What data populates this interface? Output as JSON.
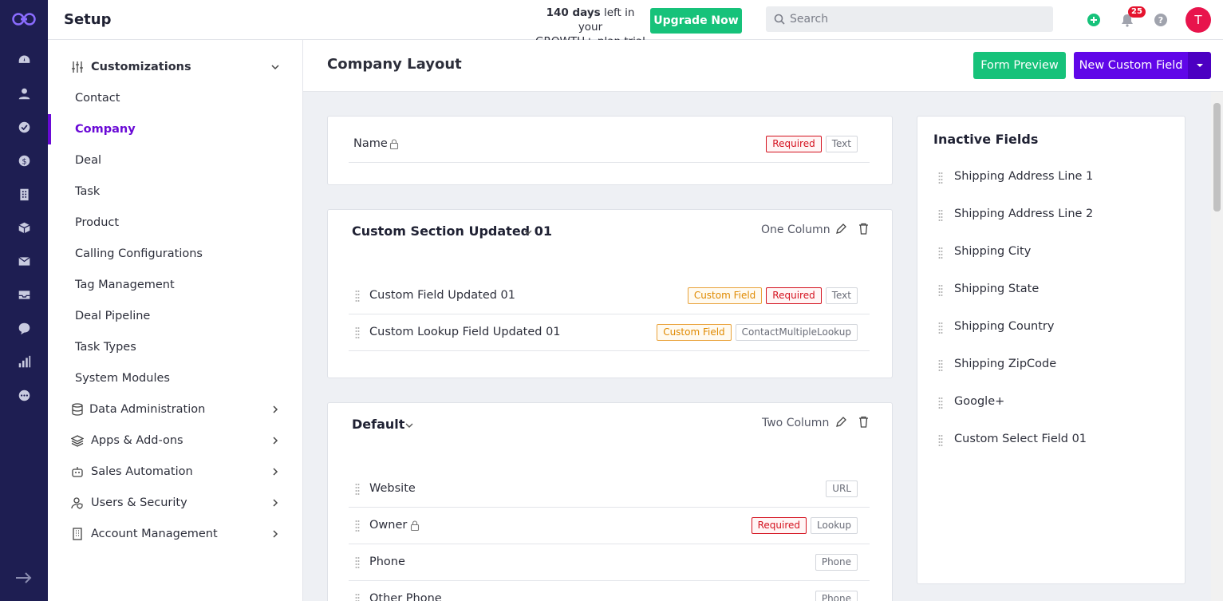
{
  "rail": {
    "icons": [
      "dashboard-icon",
      "contacts-icon",
      "tasks-icon",
      "deals-icon",
      "companies-icon",
      "products-icon",
      "email-icon",
      "inbox-icon",
      "chat-icon",
      "reports-icon",
      "more-icon"
    ],
    "accent": "#1e1e52"
  },
  "topbar": {
    "title": "Setup",
    "trial_days": "140 days",
    "trial_rest1": " left in your",
    "trial_line2": "GROWTH+ plan trial",
    "upgrade_label": "Upgrade Now",
    "search_placeholder": "Search",
    "notification_count": "25",
    "avatar_initial": "T"
  },
  "sidebar": {
    "customizations_label": "Customizations",
    "items": [
      "Contact",
      "Company",
      "Deal",
      "Task",
      "Product",
      "Calling Configurations",
      "Tag Management",
      "Deal Pipeline",
      "Task Types",
      "System Modules"
    ],
    "active_item": "Company",
    "groups": [
      "Data Administration",
      "Apps & Add-ons",
      "Sales Automation",
      "Users & Security",
      "Account Management"
    ]
  },
  "content": {
    "title": "Company Layout",
    "form_preview_label": "Form Preview",
    "new_field_label": "New Custom Field",
    "name_field": {
      "name": "Name",
      "tags": [
        "Required",
        "Text"
      ]
    },
    "sections": [
      {
        "title": "Custom Section Updated 01",
        "columns": "One Column",
        "fields": [
          {
            "name": "Custom Field Updated 01",
            "tags": [
              "Custom Field",
              "Required",
              "Text"
            ]
          },
          {
            "name": "Custom Lookup Field Updated 01",
            "tags": [
              "Custom Field",
              "ContactMultipleLookup"
            ]
          }
        ]
      },
      {
        "title": "Default",
        "columns": "Two Column",
        "fields": [
          {
            "name": "Website",
            "tags": [
              "URL"
            ]
          },
          {
            "name": "Owner",
            "tags": [
              "Required",
              "Lookup"
            ]
          },
          {
            "name": "Phone",
            "tags": [
              "Phone"
            ]
          },
          {
            "name": "Other Phone",
            "tags": [
              "Phone"
            ]
          }
        ]
      }
    ],
    "inactive_title": "Inactive Fields",
    "inactive_fields": [
      "Shipping Address Line 1",
      "Shipping Address Line 2",
      "Shipping City",
      "Shipping State",
      "Shipping Country",
      "Shipping ZipCode",
      "Google+",
      "Custom Select Field 01"
    ]
  },
  "colors": {
    "primary": "#6006e8",
    "success": "#16c27a",
    "required": "#d4111e",
    "custom": "#e08a00"
  }
}
